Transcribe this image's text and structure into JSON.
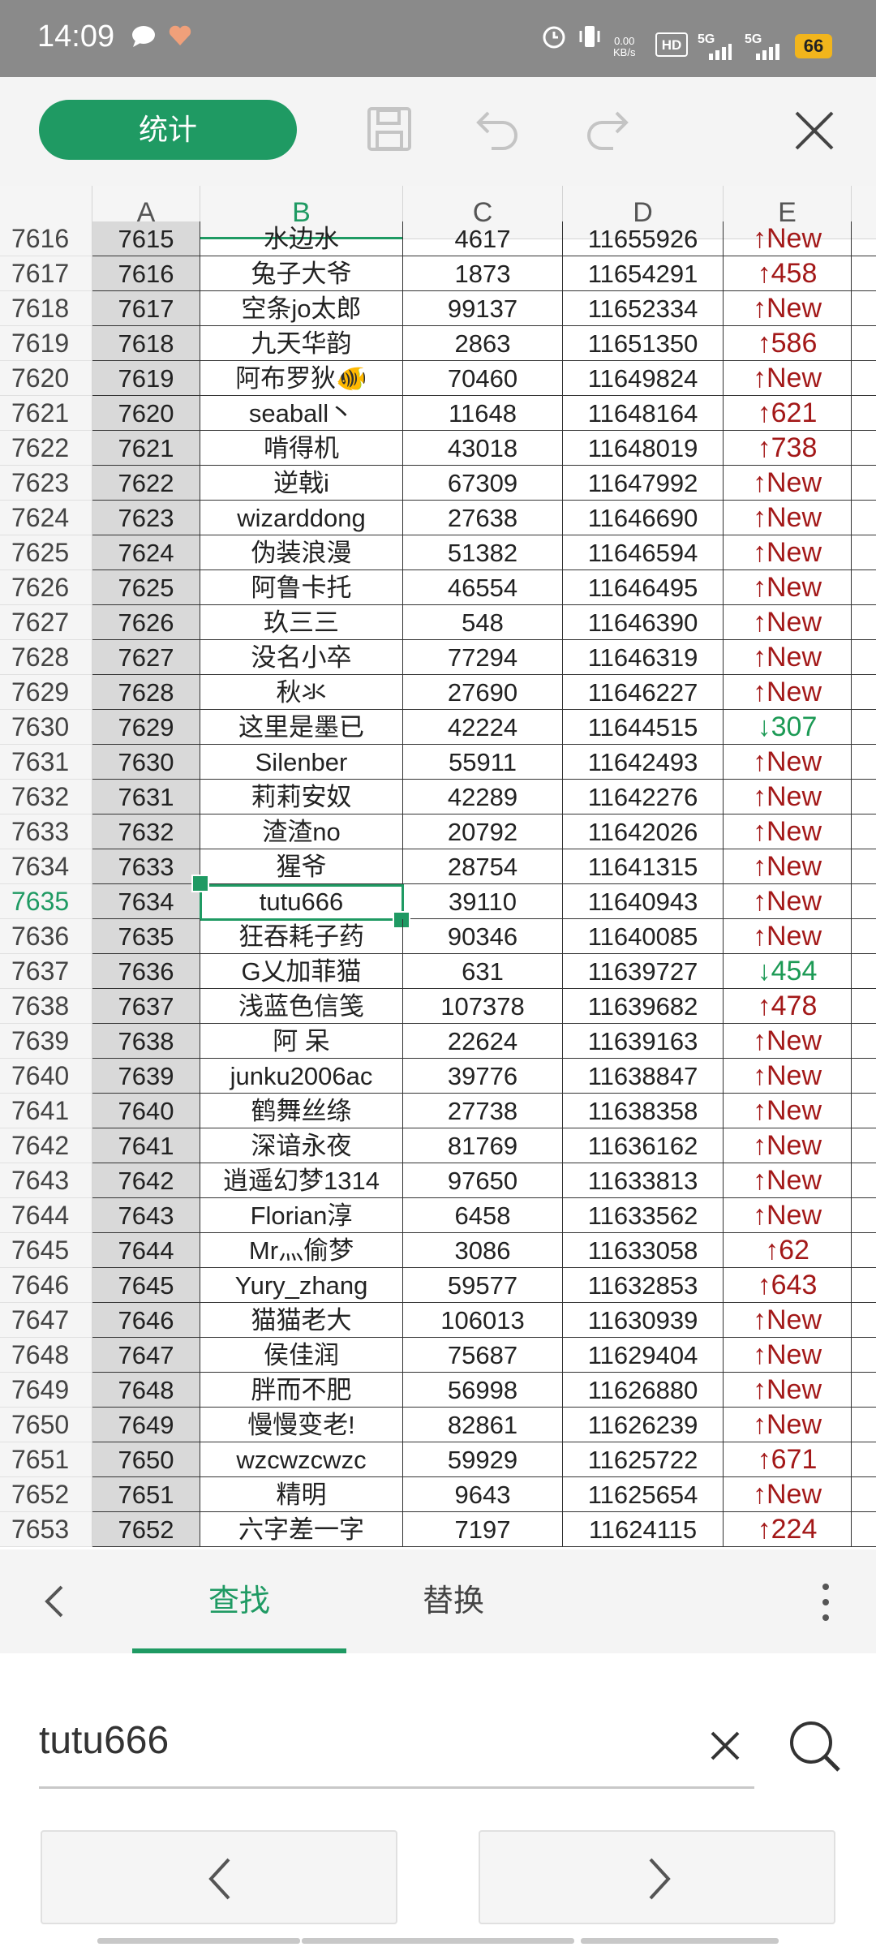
{
  "status_bar": {
    "time": "14:09",
    "net_speed": "0.00",
    "net_unit": "KB/s",
    "signal1": "5G",
    "signal2": "5G",
    "battery": "66",
    "hd_label": "HD"
  },
  "toolbar": {
    "stat_label": "统计",
    "icons": [
      "save-icon",
      "undo-icon",
      "redo-icon",
      "close-icon"
    ]
  },
  "sheet": {
    "columns": [
      "A",
      "B",
      "C",
      "D",
      "E"
    ],
    "active_row": "7635",
    "selected_cell": "B7635",
    "rows": [
      {
        "r": "7616",
        "a": "7615",
        "b": "水边水",
        "c": "4617",
        "d": "11655926",
        "dir": "↑",
        "e": "New"
      },
      {
        "r": "7617",
        "a": "7616",
        "b": "兔子大爷",
        "c": "1873",
        "d": "11654291",
        "dir": "↑",
        "e": "458"
      },
      {
        "r": "7618",
        "a": "7617",
        "b": "空条jo太郎",
        "c": "99137",
        "d": "11652334",
        "dir": "↑",
        "e": "New"
      },
      {
        "r": "7619",
        "a": "7618",
        "b": "九天华韵",
        "c": "2863",
        "d": "11651350",
        "dir": "↑",
        "e": "586"
      },
      {
        "r": "7620",
        "a": "7619",
        "b": "阿布罗狄🐠",
        "c": "70460",
        "d": "11649824",
        "dir": "↑",
        "e": "New"
      },
      {
        "r": "7621",
        "a": "7620",
        "b": "seaball丶",
        "c": "11648",
        "d": "11648164",
        "dir": "↑",
        "e": "621"
      },
      {
        "r": "7622",
        "a": "7621",
        "b": "啃得机",
        "c": "43018",
        "d": "11648019",
        "dir": "↑",
        "e": "738"
      },
      {
        "r": "7623",
        "a": "7622",
        "b": "逆戟i",
        "c": "67309",
        "d": "11647992",
        "dir": "↑",
        "e": "New"
      },
      {
        "r": "7624",
        "a": "7623",
        "b": "wizarddong",
        "c": "27638",
        "d": "11646690",
        "dir": "↑",
        "e": "New"
      },
      {
        "r": "7625",
        "a": "7624",
        "b": "伪装浪漫",
        "c": "51382",
        "d": "11646594",
        "dir": "↑",
        "e": "New"
      },
      {
        "r": "7626",
        "a": "7625",
        "b": "阿鲁卡托",
        "c": "46554",
        "d": "11646495",
        "dir": "↑",
        "e": "New"
      },
      {
        "r": "7627",
        "a": "7626",
        "b": "玖三三",
        "c": "548",
        "d": "11646390",
        "dir": "↑",
        "e": "New"
      },
      {
        "r": "7628",
        "a": "7627",
        "b": "没名小卒",
        "c": "77294",
        "d": "11646319",
        "dir": "↑",
        "e": "New"
      },
      {
        "r": "7629",
        "a": "7628",
        "b": "秋氺",
        "c": "27690",
        "d": "11646227",
        "dir": "↑",
        "e": "New"
      },
      {
        "r": "7630",
        "a": "7629",
        "b": "这里是墨已",
        "c": "42224",
        "d": "11644515",
        "dir": "↓",
        "e": "307"
      },
      {
        "r": "7631",
        "a": "7630",
        "b": "Silenber",
        "c": "55911",
        "d": "11642493",
        "dir": "↑",
        "e": "New"
      },
      {
        "r": "7632",
        "a": "7631",
        "b": "莉莉安奴",
        "c": "42289",
        "d": "11642276",
        "dir": "↑",
        "e": "New"
      },
      {
        "r": "7633",
        "a": "7632",
        "b": "渣渣no",
        "c": "20792",
        "d": "11642026",
        "dir": "↑",
        "e": "New"
      },
      {
        "r": "7634",
        "a": "7633",
        "b": "猩爷",
        "c": "28754",
        "d": "11641315",
        "dir": "↑",
        "e": "New"
      },
      {
        "r": "7635",
        "a": "7634",
        "b": "tutu666",
        "c": "39110",
        "d": "11640943",
        "dir": "↑",
        "e": "New"
      },
      {
        "r": "7636",
        "a": "7635",
        "b": "狂吞耗子药",
        "c": "90346",
        "d": "11640085",
        "dir": "↑",
        "e": "New"
      },
      {
        "r": "7637",
        "a": "7636",
        "b": "G乂加菲猫",
        "c": "631",
        "d": "11639727",
        "dir": "↓",
        "e": "454"
      },
      {
        "r": "7638",
        "a": "7637",
        "b": "浅蓝色信笺",
        "c": "107378",
        "d": "11639682",
        "dir": "↑",
        "e": "478"
      },
      {
        "r": "7639",
        "a": "7638",
        "b": "阿 呆",
        "c": "22624",
        "d": "11639163",
        "dir": "↑",
        "e": "New"
      },
      {
        "r": "7640",
        "a": "7639",
        "b": "junku2006ac",
        "c": "39776",
        "d": "11638847",
        "dir": "↑",
        "e": "New"
      },
      {
        "r": "7641",
        "a": "7640",
        "b": "鹤舞丝绦",
        "c": "27738",
        "d": "11638358",
        "dir": "↑",
        "e": "New"
      },
      {
        "r": "7642",
        "a": "7641",
        "b": "深谙永夜",
        "c": "81769",
        "d": "11636162",
        "dir": "↑",
        "e": "New"
      },
      {
        "r": "7643",
        "a": "7642",
        "b": "逍遥幻梦1314",
        "c": "97650",
        "d": "11633813",
        "dir": "↑",
        "e": "New"
      },
      {
        "r": "7644",
        "a": "7643",
        "b": "Florian淳",
        "c": "6458",
        "d": "11633562",
        "dir": "↑",
        "e": "New"
      },
      {
        "r": "7645",
        "a": "7644",
        "b": "Mr灬偷梦",
        "c": "3086",
        "d": "11633058",
        "dir": "↑",
        "e": "62"
      },
      {
        "r": "7646",
        "a": "7645",
        "b": "Yury_zhang",
        "c": "59577",
        "d": "11632853",
        "dir": "↑",
        "e": "643"
      },
      {
        "r": "7647",
        "a": "7646",
        "b": "猫猫老大",
        "c": "106013",
        "d": "11630939",
        "dir": "↑",
        "e": "New"
      },
      {
        "r": "7648",
        "a": "7647",
        "b": "侯佳润",
        "c": "75687",
        "d": "11629404",
        "dir": "↑",
        "e": "New"
      },
      {
        "r": "7649",
        "a": "7648",
        "b": "胖而不肥",
        "c": "56998",
        "d": "11626880",
        "dir": "↑",
        "e": "New"
      },
      {
        "r": "7650",
        "a": "7649",
        "b": "慢慢变老!",
        "c": "82861",
        "d": "11626239",
        "dir": "↑",
        "e": "New"
      },
      {
        "r": "7651",
        "a": "7650",
        "b": "wzcwzcwzc",
        "c": "59929",
        "d": "11625722",
        "dir": "↑",
        "e": "671"
      },
      {
        "r": "7652",
        "a": "7651",
        "b": "精明",
        "c": "9643",
        "d": "11625654",
        "dir": "↑",
        "e": "New"
      },
      {
        "r": "7653",
        "a": "7652",
        "b": "六字差一字",
        "c": "7197",
        "d": "11624115",
        "dir": "↑",
        "e": "224"
      }
    ]
  },
  "find_panel": {
    "tabs": [
      "查找",
      "替换"
    ],
    "active_tab": "查找",
    "search_value": "tutu666"
  },
  "colors": {
    "accent": "#1f9a63",
    "up": "#a31818",
    "down": "#1c9a55"
  }
}
